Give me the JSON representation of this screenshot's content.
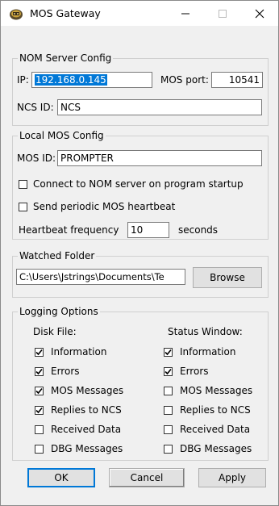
{
  "window": {
    "title": "MOS Gateway"
  },
  "nom_server": {
    "legend": "NOM Server Config",
    "ip_label": "IP:",
    "ip_value": "192.168.0.145",
    "port_label": "MOS port:",
    "port_value": "10541",
    "ncs_label": "NCS ID:",
    "ncs_value": "NCS"
  },
  "local_mos": {
    "legend": "Local MOS Config",
    "mos_id_label": "MOS ID:",
    "mos_id_value": "PROMPTER",
    "connect_label": "Connect to NOM server on program startup",
    "connect_checked": false,
    "heartbeat_label": "Send periodic MOS heartbeat",
    "heartbeat_checked": false,
    "freq_label": "Heartbeat frequency",
    "freq_value": "10",
    "freq_unit": "seconds"
  },
  "watched_folder": {
    "legend": "Watched Folder",
    "path": "C:\\Users\\Jstrings\\Documents\\Te",
    "browse_label": "Browse"
  },
  "logging": {
    "legend": "Logging Options",
    "disk_header": "Disk File:",
    "status_header": "Status Window:",
    "disk_items": [
      {
        "label": "Information",
        "checked": true
      },
      {
        "label": "Errors",
        "checked": true
      },
      {
        "label": "MOS Messages",
        "checked": true
      },
      {
        "label": "Replies to NCS",
        "checked": true
      },
      {
        "label": "Received Data",
        "checked": false
      },
      {
        "label": "DBG Messages",
        "checked": false
      }
    ],
    "status_items": [
      {
        "label": "Information",
        "checked": true
      },
      {
        "label": "Errors",
        "checked": true
      },
      {
        "label": "MOS Messages",
        "checked": false
      },
      {
        "label": "Replies to NCS",
        "checked": false
      },
      {
        "label": "Received Data",
        "checked": false
      },
      {
        "label": "DBG Messages",
        "checked": false
      }
    ]
  },
  "buttons": {
    "ok": "OK",
    "cancel": "Cancel",
    "apply": "Apply"
  }
}
